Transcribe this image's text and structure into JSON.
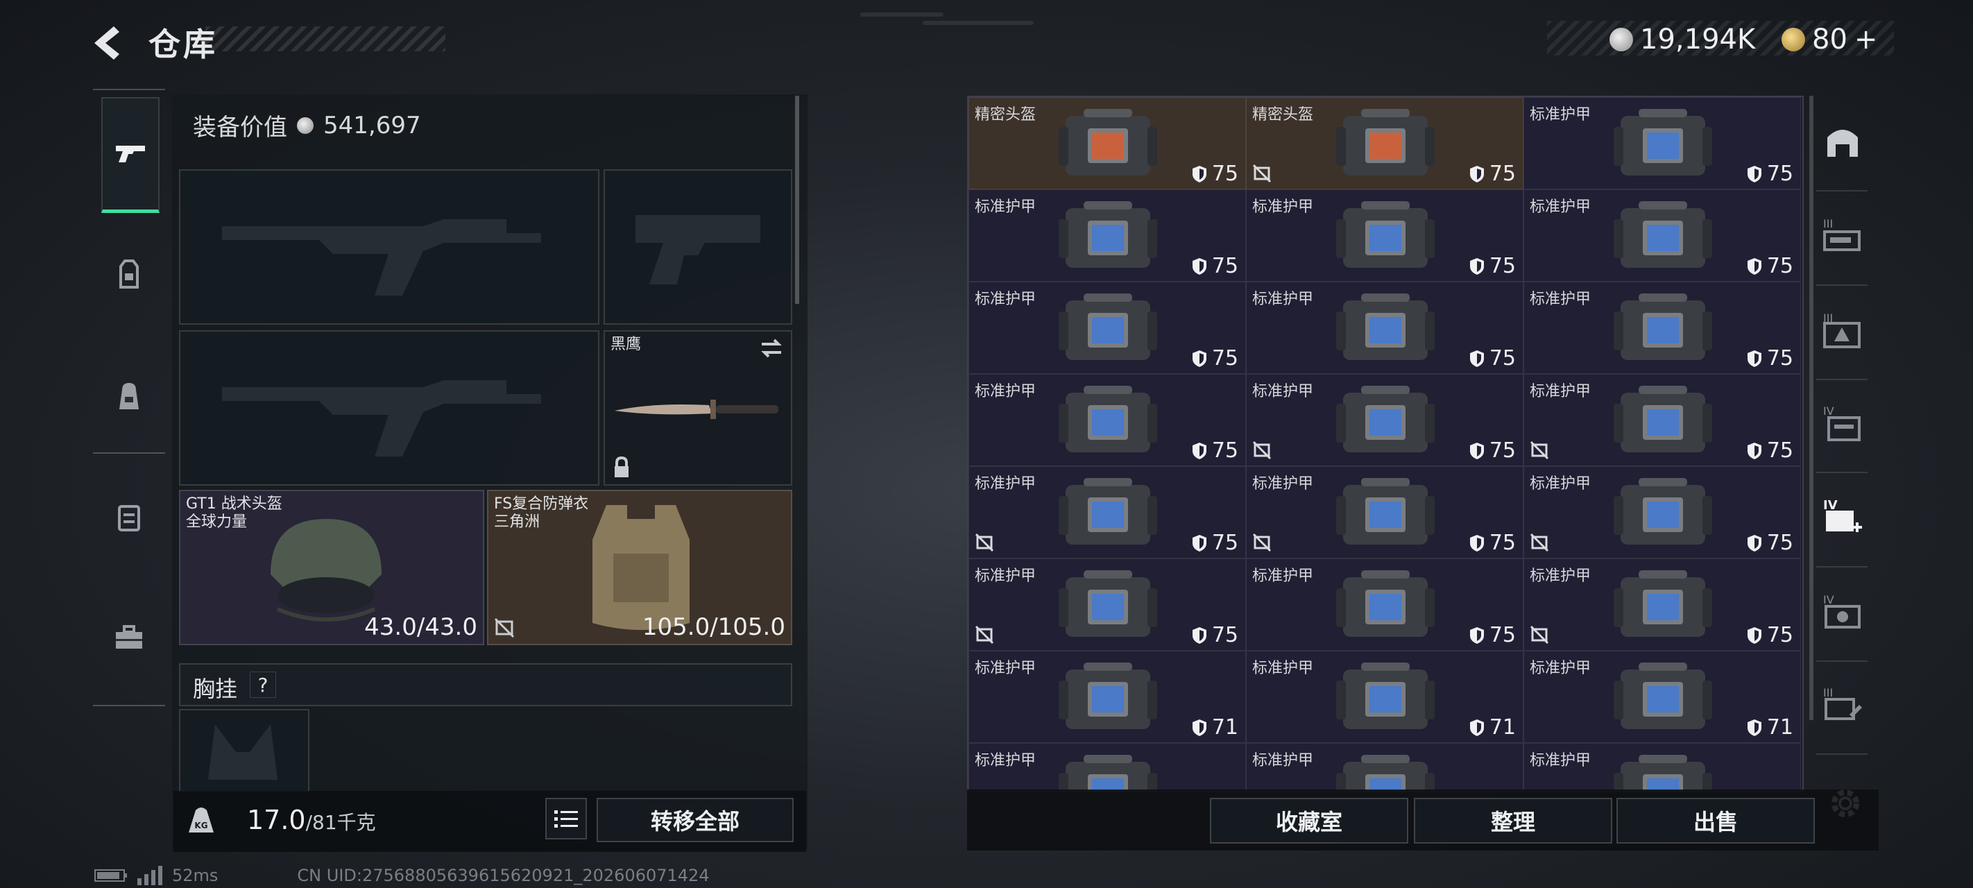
{
  "header": {
    "title": "仓库",
    "silver_amount": "19,194K",
    "gold_amount": "80",
    "add_symbol": "+"
  },
  "left_tabs": [
    {
      "icon": "pistol-icon",
      "active": true
    },
    {
      "icon": "backpack-rig-icon",
      "active": false
    },
    {
      "icon": "backpack-icon",
      "active": false
    },
    {
      "icon": "case-icon",
      "active": false
    },
    {
      "icon": "toolbox-icon",
      "active": false
    }
  ],
  "equipment": {
    "value_label": "装备价值",
    "value": "541,697",
    "knife": {
      "label": "黑鹰"
    },
    "helmet": {
      "label_line1": "GT1 战术头盔",
      "label_line2": "全球力量",
      "durability": "43.0/43.0"
    },
    "vest": {
      "label_line1": "FS复合防弹衣",
      "label_line2": "三角洲",
      "durability": "105.0/105.0"
    },
    "chest_rig_label": "胸挂",
    "chest_rig_help": "?"
  },
  "weight": {
    "current": "17.0",
    "max": "/81千克"
  },
  "transfer_all_label": "转移全部",
  "grid": {
    "cells": [
      {
        "label": "精密头盔",
        "value": "75",
        "type": "helmet",
        "no_insure": false
      },
      {
        "label": "精密头盔",
        "value": "75",
        "type": "helmet",
        "no_insure": true
      },
      {
        "label": "标准护甲",
        "value": "75",
        "type": "armor",
        "no_insure": false
      },
      {
        "label": "标准护甲",
        "value": "75",
        "type": "armor",
        "no_insure": false
      },
      {
        "label": "标准护甲",
        "value": "75",
        "type": "armor",
        "no_insure": false
      },
      {
        "label": "标准护甲",
        "value": "75",
        "type": "armor",
        "no_insure": false
      },
      {
        "label": "标准护甲",
        "value": "75",
        "type": "armor",
        "no_insure": false
      },
      {
        "label": "标准护甲",
        "value": "75",
        "type": "armor",
        "no_insure": false
      },
      {
        "label": "标准护甲",
        "value": "75",
        "type": "armor",
        "no_insure": false
      },
      {
        "label": "标准护甲",
        "value": "75",
        "type": "armor",
        "no_insure": false
      },
      {
        "label": "标准护甲",
        "value": "75",
        "type": "armor",
        "no_insure": true
      },
      {
        "label": "标准护甲",
        "value": "75",
        "type": "armor",
        "no_insure": true
      },
      {
        "label": "标准护甲",
        "value": "75",
        "type": "armor",
        "no_insure": true
      },
      {
        "label": "标准护甲",
        "value": "75",
        "type": "armor",
        "no_insure": true
      },
      {
        "label": "标准护甲",
        "value": "75",
        "type": "armor",
        "no_insure": true
      },
      {
        "label": "标准护甲",
        "value": "75",
        "type": "armor",
        "no_insure": true
      },
      {
        "label": "标准护甲",
        "value": "75",
        "type": "armor",
        "no_insure": false
      },
      {
        "label": "标准护甲",
        "value": "75",
        "type": "armor",
        "no_insure": true
      },
      {
        "label": "标准护甲",
        "value": "71",
        "type": "armor",
        "no_insure": false
      },
      {
        "label": "标准护甲",
        "value": "71",
        "type": "armor",
        "no_insure": false
      },
      {
        "label": "标准护甲",
        "value": "71",
        "type": "armor",
        "no_insure": false
      },
      {
        "label": "标准护甲",
        "value": "",
        "type": "armor",
        "no_insure": false
      },
      {
        "label": "标准护甲",
        "value": "",
        "type": "armor",
        "no_insure": false
      },
      {
        "label": "标准护甲",
        "value": "",
        "type": "armor",
        "no_insure": false
      }
    ]
  },
  "right_sidebar": {
    "icons": [
      "vault-arch-icon",
      "tier3-weapon-icon",
      "tier3-warning-icon",
      "tier4-stack-icon",
      "tier4-add-icon",
      "tier4-camera-icon",
      "tier3-edit-icon"
    ]
  },
  "bottom_buttons": {
    "collection": "收藏室",
    "organize": "整理",
    "sell": "出售"
  },
  "status": {
    "ping": "52ms",
    "uid": "CN UID:27568805639615620921_202606071424"
  }
}
